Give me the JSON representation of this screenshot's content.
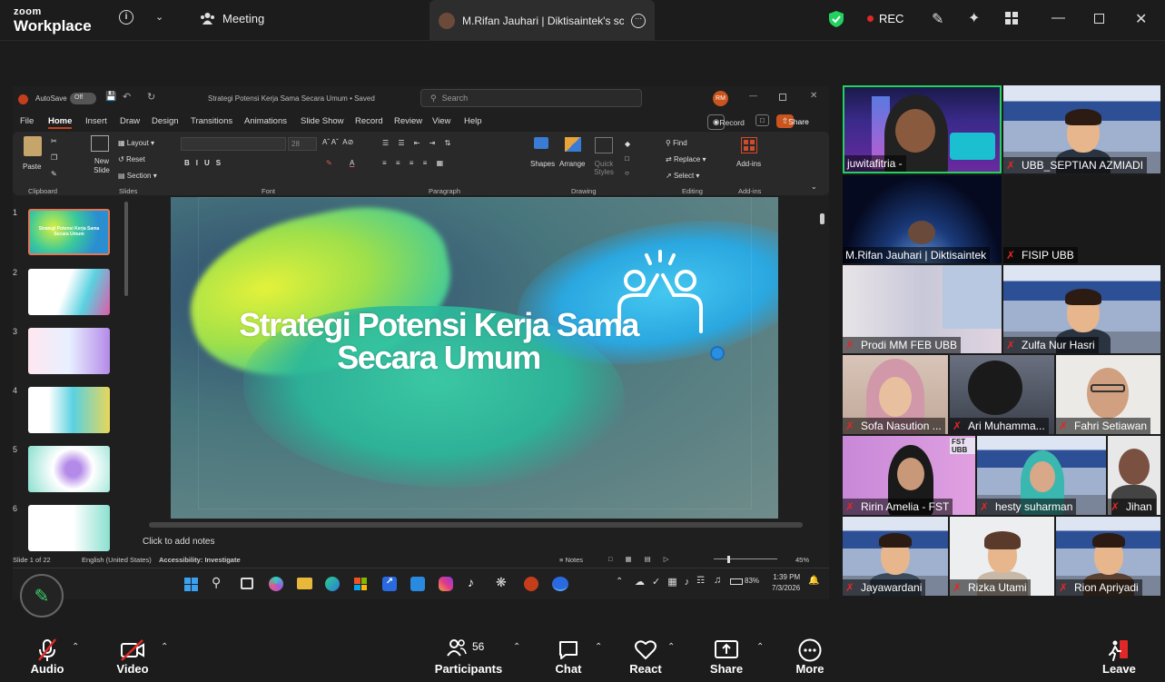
{
  "topbar": {
    "logo_line1": "zoom",
    "logo_line2": "Workplace",
    "meeting_label": "Meeting",
    "share_title": "M.Rifan Jauhari | Diktisaintek's scr",
    "rec_label": "REC"
  },
  "ppt": {
    "autosave": "AutoSave",
    "toggle": "Off",
    "doc_title": "Strategi Potensi Kerja Sama Secara Umum",
    "saved": "Saved",
    "search_placeholder": "Search",
    "user_initials": "RM",
    "tabs": [
      "File",
      "Home",
      "Insert",
      "Draw",
      "Design",
      "Transitions",
      "Animations",
      "Slide Show",
      "Record",
      "Review",
      "View",
      "Help"
    ],
    "record_btn": "Record",
    "share_btn": "Share",
    "groups": {
      "clipboard": "Clipboard",
      "slides": "Slides",
      "font": "Font",
      "paragraph": "Paragraph",
      "drawing": "Drawing",
      "editing": "Editing",
      "addins": "Add-ins"
    },
    "buttons": {
      "paste": "Paste",
      "new_slide": "New Slide",
      "layout": "Layout",
      "reset": "Reset",
      "section": "Section",
      "font_size": "28",
      "shapes": "Shapes",
      "arrange": "Arrange",
      "quick_styles": "Quick Styles",
      "find": "Find",
      "replace": "Replace",
      "select": "Select",
      "addins": "Add-ins"
    },
    "slide_numbers": [
      "1",
      "2",
      "3",
      "4",
      "5",
      "6"
    ],
    "slide_title_line1": "Strategi Potensi Kerja Sama",
    "slide_title_line2": "Secara Umum",
    "thumb1_title": "Strategi Potensi Kerja Sama Secara Umum",
    "notes_placeholder": "Click to add notes",
    "status": {
      "slide_of": "Slide 1 of 22",
      "language": "English (United States)",
      "accessibility": "Accessibility: Investigate",
      "notes": "Notes",
      "zoom": "45%"
    },
    "taskbar": {
      "battery": "83%",
      "time": "1:39 PM",
      "date": "7/3/2026"
    }
  },
  "participants_gallery": [
    {
      "name": "juwitafitria -",
      "muted": false
    },
    {
      "name": "UBB_SEPTIAN AZMIADI",
      "muted": true
    },
    {
      "name": "M.Rifan Jauhari | Diktisaintek",
      "muted": false
    },
    {
      "name": "FISIP UBB",
      "muted": true
    },
    {
      "name": "Prodi MM FEB UBB",
      "muted": true
    },
    {
      "name": "Zulfa Nur Hasri",
      "muted": true
    },
    {
      "name": "Sofa Nasution ...",
      "muted": true
    },
    {
      "name": "Ari Muhamma...",
      "muted": true
    },
    {
      "name": "Fahri Setiawan",
      "muted": true
    },
    {
      "name": "Ririn Amelia - FST",
      "muted": true
    },
    {
      "name": "hesty suharman",
      "muted": true
    },
    {
      "name": "Jihan",
      "muted": true
    },
    {
      "name": "Jayawardani",
      "muted": true
    },
    {
      "name": "Rizka Utami",
      "muted": true
    },
    {
      "name": "Rion Apriyadi",
      "muted": true
    }
  ],
  "gallery_overlay_text": "FST UBB",
  "bottombar": {
    "audio": "Audio",
    "video": "Video",
    "participants": "Participants",
    "participants_count": "56",
    "chat": "Chat",
    "react": "React",
    "share": "Share",
    "more": "More",
    "leave": "Leave"
  },
  "colors": {
    "accent_green": "#23d160",
    "rec_red": "#e02828",
    "ppt_orange": "#c43e1c",
    "leave_red": "#e02828"
  }
}
